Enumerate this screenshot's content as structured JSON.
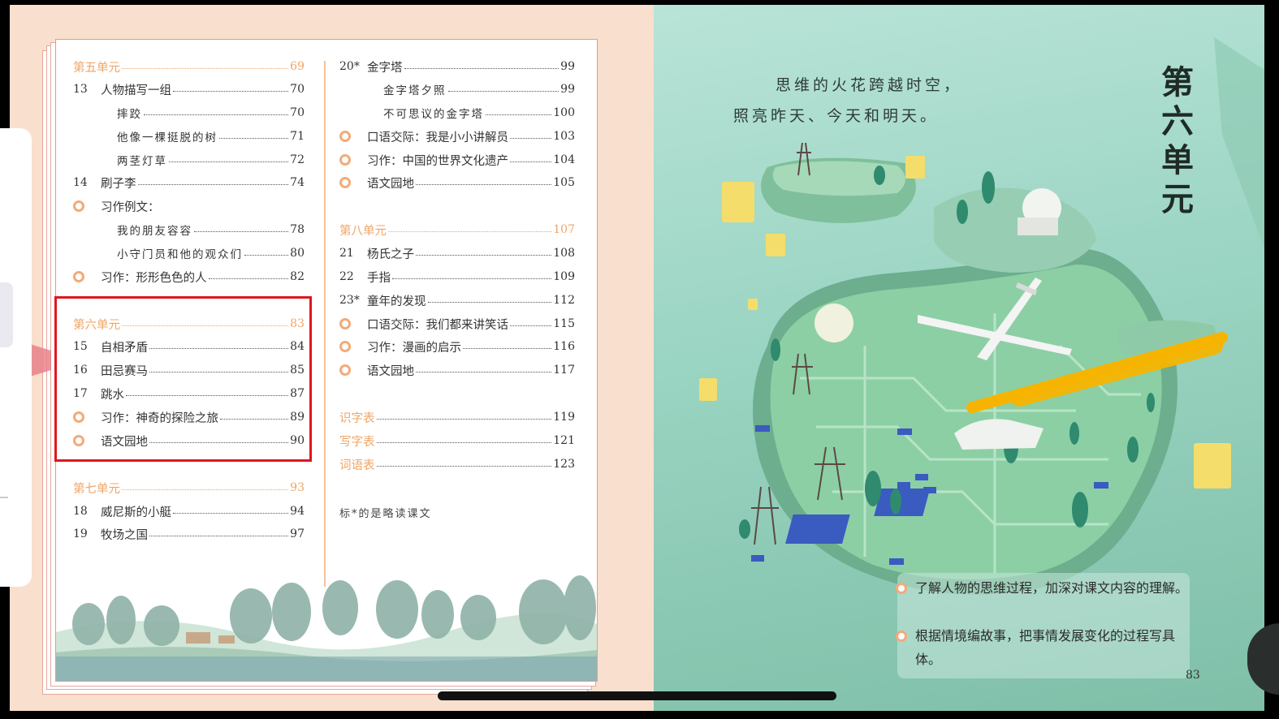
{
  "toc": {
    "left_column": [
      {
        "kind": "unit",
        "title": "第五单元",
        "page": "69"
      },
      {
        "kind": "lesson",
        "num": "13",
        "title": "人物描写一组",
        "page": "70"
      },
      {
        "kind": "sub",
        "title": "摔跤",
        "page": "70"
      },
      {
        "kind": "sub",
        "title": "他像一棵挺脱的树",
        "page": "71"
      },
      {
        "kind": "sub",
        "title": "两茎灯草",
        "page": "72"
      },
      {
        "kind": "lesson",
        "num": "14",
        "title": "刷子李",
        "page": "74"
      },
      {
        "kind": "activity",
        "title": "习作例文：",
        "page": ""
      },
      {
        "kind": "sub",
        "title": "我的朋友容容",
        "page": "78"
      },
      {
        "kind": "sub",
        "title": "小守门员和他的观众们",
        "page": "80"
      },
      {
        "kind": "activity",
        "title": "习作：形形色色的人",
        "page": "82"
      },
      {
        "kind": "unit",
        "title": "第六单元",
        "page": "83"
      },
      {
        "kind": "lesson",
        "num": "15",
        "title": "自相矛盾",
        "page": "84"
      },
      {
        "kind": "lesson",
        "num": "16",
        "title": "田忌赛马",
        "page": "85"
      },
      {
        "kind": "lesson",
        "num": "17",
        "title": "跳水",
        "page": "87"
      },
      {
        "kind": "activity",
        "title": "习作：神奇的探险之旅",
        "page": "89"
      },
      {
        "kind": "activity",
        "title": "语文园地",
        "page": "90"
      },
      {
        "kind": "unit",
        "title": "第七单元",
        "page": "93"
      },
      {
        "kind": "lesson",
        "num": "18",
        "title": "威尼斯的小艇",
        "page": "94"
      },
      {
        "kind": "lesson",
        "num": "19",
        "title": "牧场之国",
        "page": "97"
      }
    ],
    "right_column": [
      {
        "kind": "lesson",
        "num": "20*",
        "title": "金字塔",
        "page": "99"
      },
      {
        "kind": "sub",
        "title": "金字塔夕照",
        "page": "99"
      },
      {
        "kind": "sub",
        "title": "不可思议的金字塔",
        "page": "100"
      },
      {
        "kind": "activity",
        "title": "口语交际：我是小小讲解员",
        "page": "103"
      },
      {
        "kind": "activity",
        "title": "习作：中国的世界文化遗产",
        "page": "104"
      },
      {
        "kind": "activity",
        "title": "语文园地",
        "page": "105"
      },
      {
        "kind": "unit",
        "title": "第八单元",
        "page": "107"
      },
      {
        "kind": "lesson",
        "num": "21",
        "title": "杨氏之子",
        "page": "108"
      },
      {
        "kind": "lesson",
        "num": "22",
        "title": "手指",
        "page": "109"
      },
      {
        "kind": "lesson",
        "num": "23*",
        "title": "童年的发现",
        "page": "112"
      },
      {
        "kind": "activity",
        "title": "口语交际：我们都来讲笑话",
        "page": "115"
      },
      {
        "kind": "activity",
        "title": "习作：漫画的启示",
        "page": "116"
      },
      {
        "kind": "activity",
        "title": "语文园地",
        "page": "117"
      },
      {
        "kind": "appendix",
        "title": "识字表",
        "page": "119"
      },
      {
        "kind": "appendix",
        "title": "写字表",
        "page": "121"
      },
      {
        "kind": "appendix",
        "title": "词语表",
        "page": "123"
      }
    ],
    "note": "标*的是略读课文"
  },
  "unit_page": {
    "poem_line1": "思维的火花跨越时空，",
    "poem_line2": "照亮昨天、今天和明天。",
    "heading": "第六单元",
    "objectives": [
      "了解人物的思维过程，加深对课文内容的理解。",
      "根据情境编故事，把事情发展变化的过程写具体。"
    ],
    "page_number": "83"
  },
  "colors": {
    "accent_orange": "#f0a565",
    "highlight_red": "#e0161e",
    "left_page_bg": "#f9dfcd",
    "right_page_bg": "#9ad4c2",
    "marker_yellow": "#f6b400"
  }
}
